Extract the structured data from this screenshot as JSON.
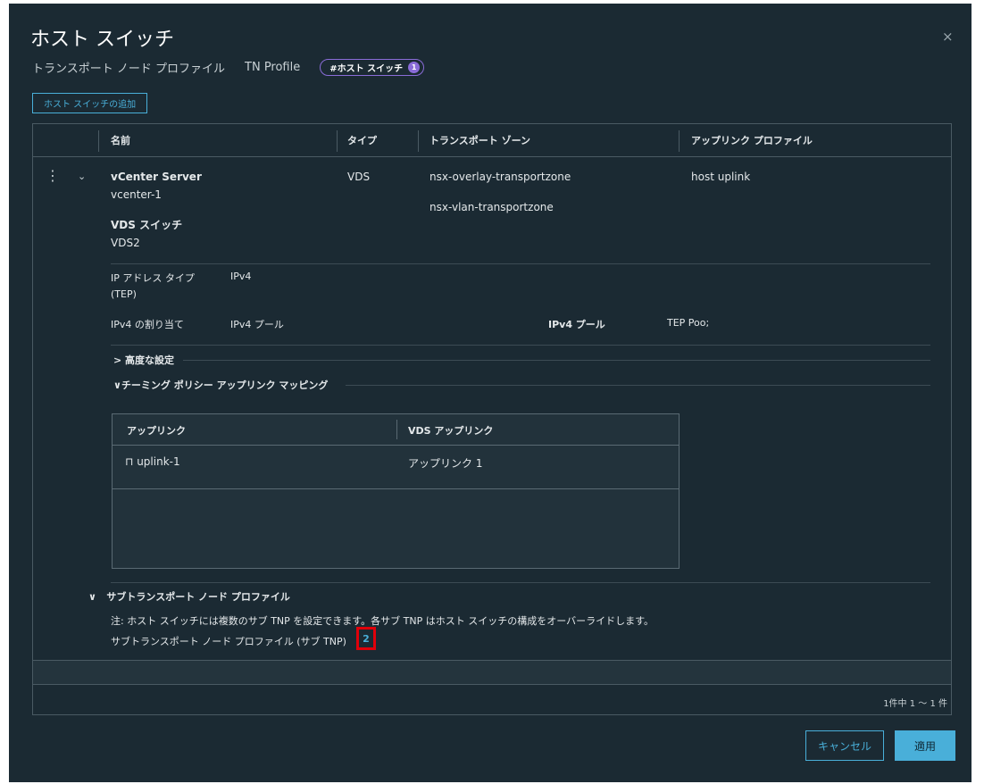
{
  "dialog": {
    "title": "ホスト スイッチ",
    "close_glyph": "×",
    "subtitle": "トランスポート ノード プロファイル",
    "profile_name": "TN Profile",
    "pill_label": "#ホスト スイッチ",
    "pill_count": "1",
    "add_button": "ホスト スイッチの追加"
  },
  "table": {
    "headers": [
      "名前",
      "タイプ",
      "トランスポート ゾーン",
      "アップリンク プロファイル"
    ],
    "row": {
      "name_title": "vCenter Server",
      "name_value": "vcenter-1",
      "vds_title": "VDS スイッチ",
      "vds_value": "VDS2",
      "type": "VDS",
      "zones": [
        "nsx-overlay-transportzone",
        "nsx-vlan-transportzone"
      ],
      "uplink_profile": "host uplink"
    },
    "kebab_glyph": "⋮",
    "chevron_glyph": "⌄"
  },
  "ip": {
    "type_label": "IP アドレス タイプ",
    "type_label2": "(TEP)",
    "type_value": "IPv4",
    "assign_label": "IPv4 の割り当て",
    "assign_value": "IPv4 プール",
    "pool_label": "IPv4 プール",
    "pool_value": "TEP Poo;"
  },
  "sections": {
    "advanced": "高度な設定",
    "teaming": "チーミング ポリシー アップリンク マッピング",
    "sub_tnp": "サブトランスポート ノード プロファイル",
    "note": "注: ホスト スイッチには複数のサブ TNP を設定できます。各サブ TNP はホスト スイッチの構成をオーバーライドします。",
    "sub_tnp_count_label": "サブトランスポート ノード プロファイル (サブ TNP)",
    "sub_tnp_count": "2"
  },
  "uplink_table": {
    "headers": [
      "アップリンク",
      "VDS アップリンク"
    ],
    "rows": [
      {
        "uplink": "uplink-1",
        "vds_uplink": "アップリンク 1"
      }
    ]
  },
  "pagination": "1件中 1 ～ 1 件",
  "buttons": {
    "cancel": "キャンセル",
    "apply": "適用"
  },
  "colors": {
    "background": "#1b2a33",
    "accent": "#49afd9",
    "badge": "#8a6cd8",
    "highlight": "#e0000a"
  }
}
